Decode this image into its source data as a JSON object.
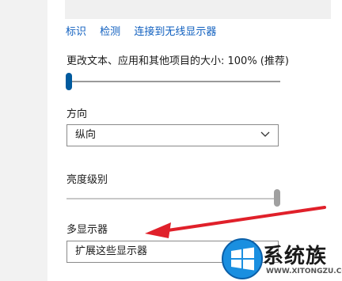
{
  "display": {
    "links": [
      "标识",
      "检测",
      "连接到无线显示器"
    ],
    "scale_label": "更改文本、应用和其他项目的大小: 100% (推荐)",
    "scale_slider_level": 0,
    "orientation_label": "方向",
    "orientation_value": "纵向",
    "brightness_label": "亮度级别",
    "brightness_slider_level": 1.0,
    "multi_display_label": "多显示器",
    "multi_display_value": "扩展这些显示器"
  },
  "colors": {
    "accent": "#005a9e",
    "link": "#0f5fbf",
    "arrow": "#e0202a"
  },
  "watermark": {
    "text": "系统族",
    "url": "WWW.XITONGZU.COM"
  }
}
